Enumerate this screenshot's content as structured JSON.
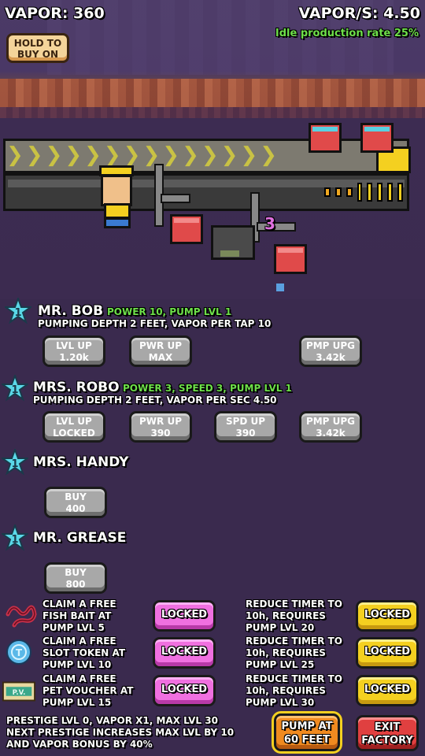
{
  "header": {
    "vapor": "VAPOR: 360",
    "vapor_per_sec": "VAPOR/S: 4.50",
    "idle_rate": "Idle production rate 25%",
    "hold_line1": "HOLD TO",
    "hold_line2": "BUY ON"
  },
  "scene": {
    "robot_count": "3"
  },
  "workers": [
    {
      "star": "1",
      "name": "MR. BOB",
      "stats": "POWER 10, PUMP LVL 1",
      "desc": "PUMPING DEPTH 2 FEET, VAPOR PER TAP 10",
      "buttons": [
        {
          "top": "LVL UP",
          "bottom": "1.20k"
        },
        {
          "top": "PWR UP",
          "bottom": "MAX"
        },
        {
          "top": "PMP UPG",
          "bottom": "3.42k"
        }
      ]
    },
    {
      "star": "1",
      "name": "MRS. ROBO",
      "stats": "POWER 3, SPEED 3, PUMP LVL 1",
      "desc": "PUMPING DEPTH 2 FEET, VAPOR PER SEC 4.50",
      "buttons": [
        {
          "top": "LVL UP",
          "bottom": "LOCKED"
        },
        {
          "top": "PWR UP",
          "bottom": "390"
        },
        {
          "top": "SPD UP",
          "bottom": "390"
        },
        {
          "top": "PMP UPG",
          "bottom": "3.42k"
        }
      ]
    },
    {
      "star": "1",
      "name": "MRS. HANDY",
      "buy_top": "BUY",
      "buy_bottom": "400"
    },
    {
      "star": "1",
      "name": "MR. GREASE",
      "buy_top": "BUY",
      "buy_bottom": "800"
    }
  ],
  "rewards": {
    "claims": [
      {
        "icon": "worm-bait-icon",
        "l1": "CLAIM A FREE",
        "l2": "FISH BAIT AT",
        "l3": "PUMP LVL 5",
        "button": "LOCKED"
      },
      {
        "icon": "slot-token-icon",
        "l1": "CLAIM A FREE",
        "l2": "SLOT TOKEN AT",
        "l3": "PUMP LVL 10",
        "button": "LOCKED"
      },
      {
        "icon": "pet-voucher-icon",
        "l1": "CLAIM A FREE",
        "l2": "PET VOUCHER AT",
        "l3": "PUMP LVL 15",
        "button": "LOCKED"
      }
    ],
    "timers": [
      {
        "l1": "REDUCE TIMER TO",
        "l2": "10h, REQUIRES",
        "l3": "PUMP LVL 20",
        "button": "LOCKED"
      },
      {
        "l1": "REDUCE TIMER TO",
        "l2": "10h, REQUIRES",
        "l3": "PUMP LVL 25",
        "button": "LOCKED"
      },
      {
        "l1": "REDUCE TIMER TO",
        "l2": "10h, REQUIRES",
        "l3": "PUMP LVL 30",
        "button": "LOCKED"
      }
    ],
    "pet_voucher_label": "P.V."
  },
  "footer": {
    "prestige_l1": "PRESTIGE LVL 0, VAPOR X1, MAX LVL 30",
    "prestige_l2": "NEXT PRESTIGE INCREASES MAX LVL BY 10",
    "prestige_l3": "AND VAPOR BONUS BY 40%",
    "pump_l1": "PUMP AT",
    "pump_l2": "60 FEET",
    "exit_l1": "EXIT",
    "exit_l2": "FACTORY"
  },
  "colors": {
    "background": "#3a2a4e",
    "green_stat": "#6ee04a",
    "locked_pink": "#f070e0",
    "locked_yellow": "#f4d020",
    "star_cyan": "#5ad8e8"
  }
}
